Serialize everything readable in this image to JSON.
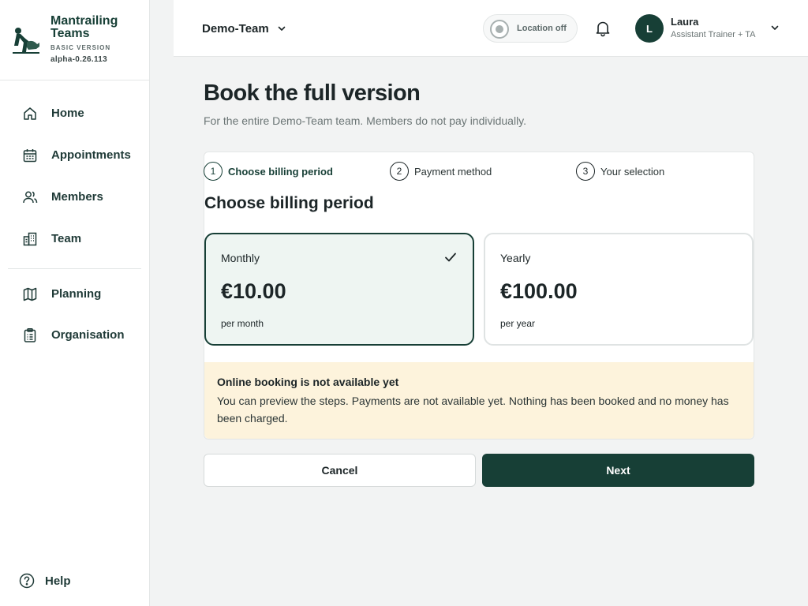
{
  "brand": {
    "title": "Mantrailing Teams",
    "tier": "BASIC VERSION",
    "version": "alpha-0.26.113"
  },
  "sidebar": {
    "items": [
      {
        "label": "Home",
        "icon": "home-icon"
      },
      {
        "label": "Appointments",
        "icon": "calendar-icon"
      },
      {
        "label": "Members",
        "icon": "users-icon"
      },
      {
        "label": "Team",
        "icon": "building-icon"
      },
      {
        "label": "Planning",
        "icon": "map-icon"
      },
      {
        "label": "Organisation",
        "icon": "clipboard-icon"
      }
    ],
    "help_label": "Help"
  },
  "topbar": {
    "team": "Demo-Team",
    "location": "Location off",
    "user": {
      "initial": "L",
      "name": "Laura",
      "role": "Assistant Trainer + TA"
    }
  },
  "page": {
    "title": "Book the full version",
    "subtitle": "For the entire Demo-Team team. Members do not pay individually."
  },
  "steps": [
    {
      "num": "1",
      "label": "Choose billing period",
      "active": true
    },
    {
      "num": "2",
      "label": "Payment method",
      "active": false
    },
    {
      "num": "3",
      "label": "Your selection",
      "active": false
    }
  ],
  "section_title": "Choose billing period",
  "plans": [
    {
      "name": "Monthly",
      "price": "€10.00",
      "per": "per month",
      "selected": true
    },
    {
      "name": "Yearly",
      "price": "€100.00",
      "per": "per year",
      "selected": false
    }
  ],
  "notice": {
    "heading": "Online booking is not available yet",
    "body": "You can preview the steps. Payments are not available yet. Nothing has been booked and no money has been charged."
  },
  "buttons": {
    "cancel": "Cancel",
    "next": "Next"
  },
  "colors": {
    "brand": "#173f36",
    "notice_bg": "#fdf3dc",
    "selected_bg": "#eef5f2"
  }
}
